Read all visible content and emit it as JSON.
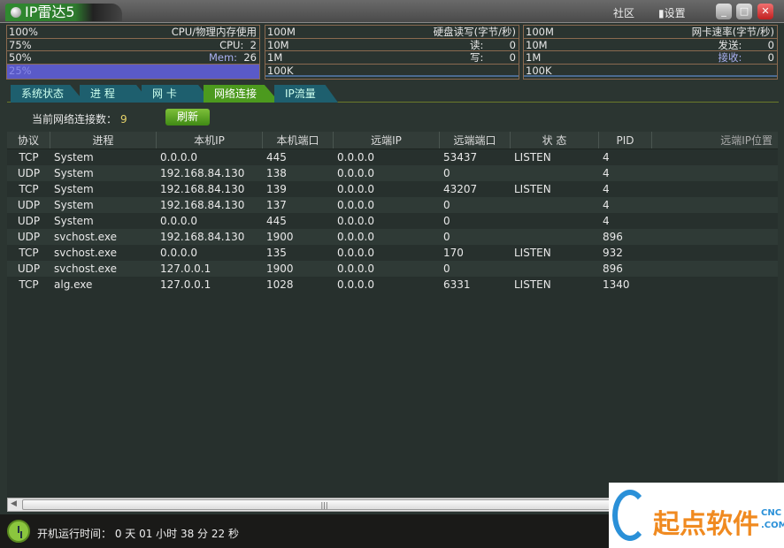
{
  "app": {
    "title": "IP雷达5",
    "community": "社区",
    "settings": "设置"
  },
  "cpu_panel": {
    "title": "CPU/物理内存使用",
    "levels": [
      "100%",
      "75%",
      "50%",
      "25%"
    ],
    "cpu_label": "CPU:",
    "cpu_value": "2",
    "mem_label": "Mem:",
    "mem_value": "26"
  },
  "disk_panel": {
    "title": "硬盘读写(字节/秒)",
    "levels": [
      "100M",
      "10M",
      "1M",
      "100K"
    ],
    "read_label": "读:",
    "read_value": "0",
    "write_label": "写:",
    "write_value": "0"
  },
  "net_panel": {
    "title": "网卡速率(字节/秒)",
    "levels": [
      "100M",
      "10M",
      "1M",
      "100K"
    ],
    "send_label": "发送:",
    "send_value": "0",
    "recv_label": "接收:",
    "recv_value": "0"
  },
  "tabs": [
    {
      "label": "系统状态"
    },
    {
      "label": "进 程"
    },
    {
      "label": "网 卡"
    },
    {
      "label": "网络连接",
      "active": true
    },
    {
      "label": "IP流量"
    }
  ],
  "connections": {
    "count_label": "当前网络连接数：",
    "count": "9",
    "refresh": "刷新"
  },
  "table": {
    "headers": [
      "协议",
      "进程",
      "本机IP",
      "本机端口",
      "远端IP",
      "远端端口",
      "状 态",
      "PID",
      "远端IP位置"
    ],
    "rows": [
      [
        "TCP",
        "System",
        "0.0.0.0",
        "445",
        "0.0.0.0",
        "53437",
        "LISTEN",
        "4",
        ""
      ],
      [
        "UDP",
        "System",
        "192.168.84.130",
        "138",
        "0.0.0.0",
        "0",
        "",
        "4",
        ""
      ],
      [
        "TCP",
        "System",
        "192.168.84.130",
        "139",
        "0.0.0.0",
        "43207",
        "LISTEN",
        "4",
        ""
      ],
      [
        "UDP",
        "System",
        "192.168.84.130",
        "137",
        "0.0.0.0",
        "0",
        "",
        "4",
        ""
      ],
      [
        "UDP",
        "System",
        "0.0.0.0",
        "445",
        "0.0.0.0",
        "0",
        "",
        "4",
        ""
      ],
      [
        "UDP",
        "svchost.exe",
        "192.168.84.130",
        "1900",
        "0.0.0.0",
        "0",
        "",
        "896",
        ""
      ],
      [
        "TCP",
        "svchost.exe",
        "0.0.0.0",
        "135",
        "0.0.0.0",
        "170",
        "LISTEN",
        "932",
        ""
      ],
      [
        "UDP",
        "svchost.exe",
        "127.0.0.1",
        "1900",
        "0.0.0.0",
        "0",
        "",
        "896",
        ""
      ],
      [
        "TCP",
        "alg.exe",
        "127.0.0.1",
        "1028",
        "0.0.0.0",
        "6331",
        "LISTEN",
        "1340",
        ""
      ]
    ]
  },
  "status": {
    "uptime": "开机运行时间： 0 天 01 小时 38 分 22 秒"
  },
  "watermark": {
    "text": "起点软件",
    "sub1": "CNC",
    "sub2": ".COM"
  }
}
